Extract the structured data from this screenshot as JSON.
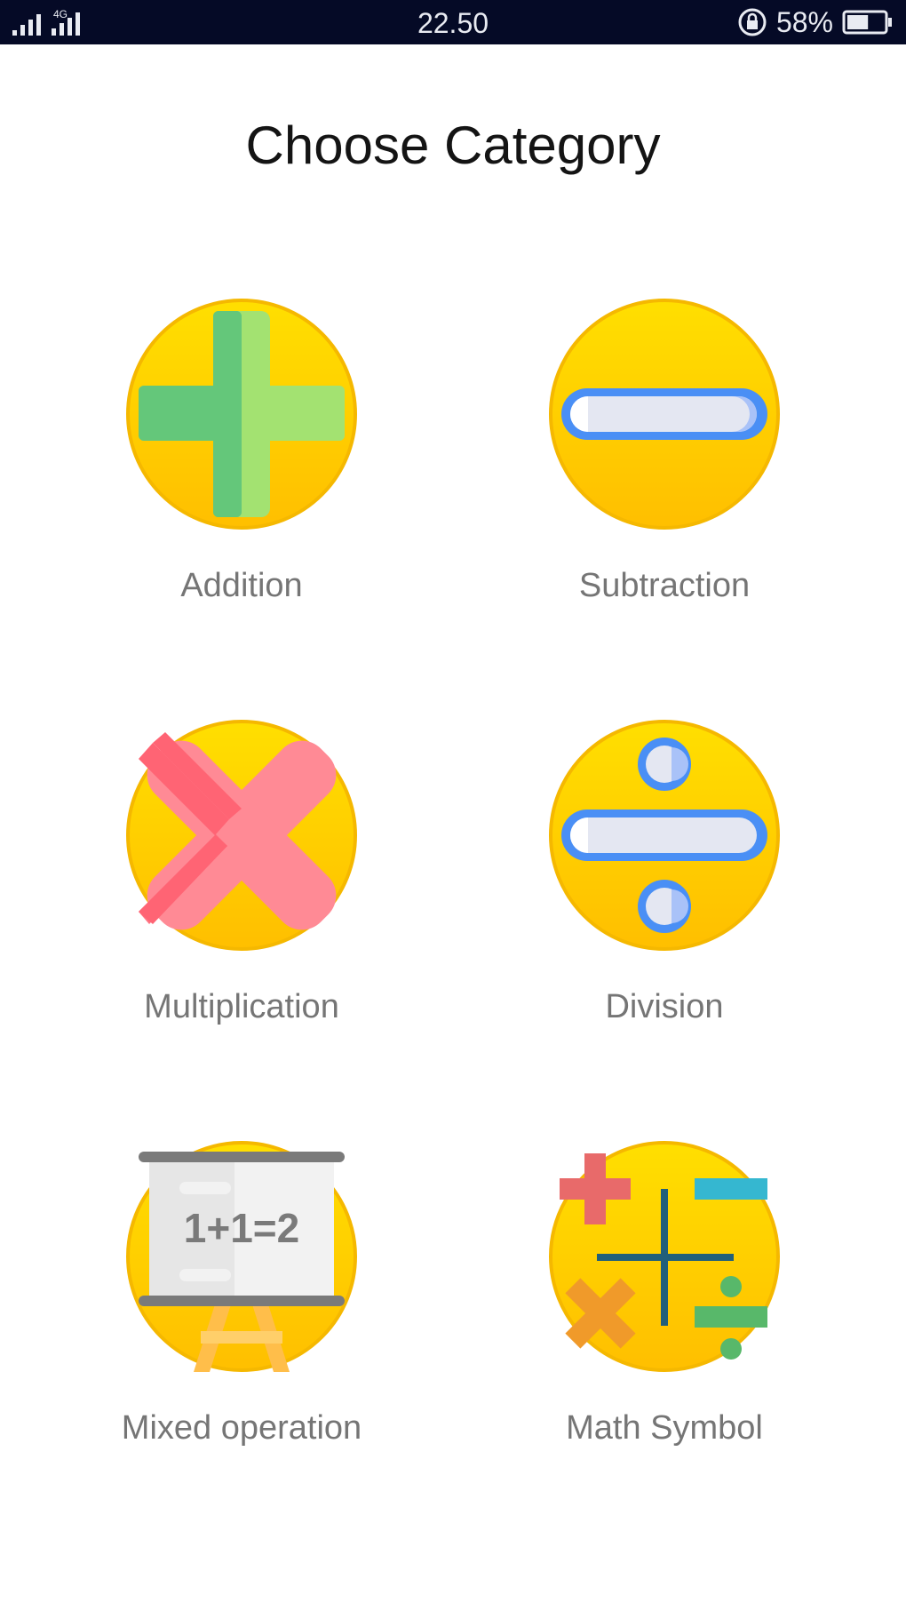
{
  "status_bar": {
    "network": "4G",
    "time": "22.50",
    "battery_percent": "58%",
    "battery_level": 0.58
  },
  "page": {
    "title": "Choose Category"
  },
  "categories": [
    {
      "label": "Addition",
      "icon": "plus-icon"
    },
    {
      "label": "Subtraction",
      "icon": "minus-icon"
    },
    {
      "label": "Multiplication",
      "icon": "multiply-icon"
    },
    {
      "label": "Division",
      "icon": "divide-icon"
    },
    {
      "label": "Mixed operation",
      "icon": "blackboard-icon",
      "board_text": "1+1=2"
    },
    {
      "label": "Math Symbol",
      "icon": "math-symbols-icon"
    }
  ],
  "colors": {
    "status_bar_bg": "#050a26",
    "icon_circle": "#ffcb05",
    "label_text": "#757575",
    "title_text": "#141414"
  }
}
